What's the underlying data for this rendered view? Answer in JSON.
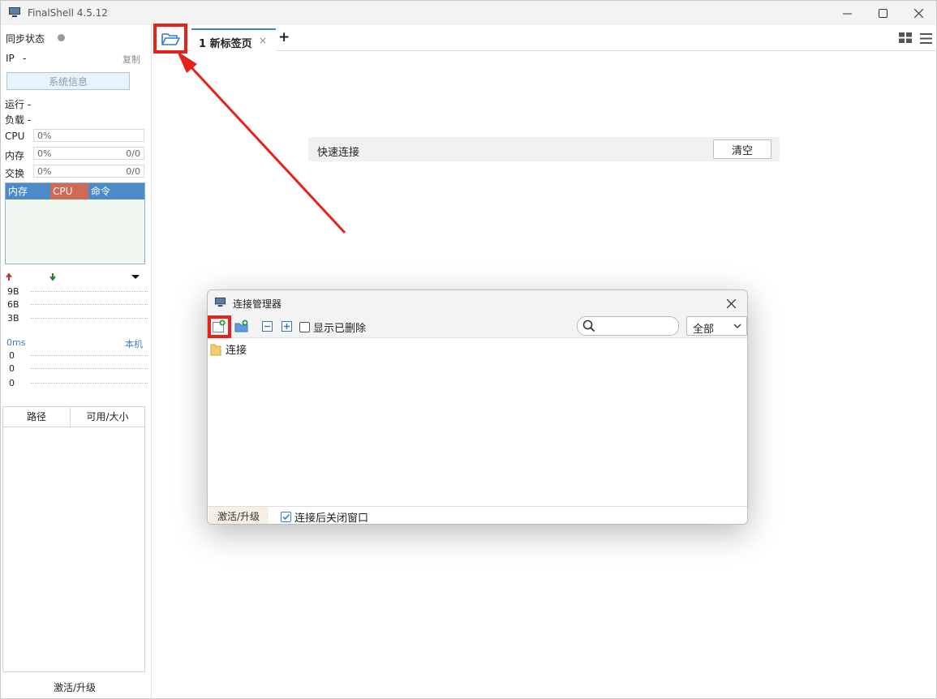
{
  "window": {
    "title": "FinalShell 4.5.12"
  },
  "sidebar": {
    "sync_status_label": "同步状态",
    "ip_label": "IP",
    "ip_value": "-",
    "copy_label": "复制",
    "sysinfo_button": "系统信息",
    "uptime": "运行 -",
    "load": "负载 -",
    "meters": [
      {
        "label": "CPU",
        "left": "0%",
        "right": ""
      },
      {
        "label": "内存",
        "left": "0%",
        "right": "0/0"
      },
      {
        "label": "交换",
        "left": "0%",
        "right": "0/0"
      }
    ],
    "process_headers": {
      "mem": "内存",
      "cpu": "CPU",
      "cmd": "命令"
    },
    "net_scale": [
      "9B",
      "6B",
      "3B"
    ],
    "ping_label": "0ms",
    "ping_target": "本机",
    "ping_scale": [
      "0",
      "0",
      "0"
    ],
    "disk_headers": {
      "path": "路径",
      "size": "可用/大小"
    },
    "activate_label": "激活/升级"
  },
  "tabs": {
    "items": [
      {
        "label": "1 新标签页",
        "close": "×"
      }
    ],
    "add": "+"
  },
  "quick_connect": {
    "label": "快速连接",
    "clear_button": "清空"
  },
  "dialog": {
    "title": "连接管理器",
    "show_deleted_label": "显示已删除",
    "search_placeholder": "",
    "filter_value": "全部",
    "tree": [
      {
        "label": "连接"
      }
    ],
    "activate_label": "激活/升级",
    "close_after_connect_label": "连接后关闭窗口",
    "close_after_connect_checked": true
  },
  "colors": {
    "accent": "#3b84d4",
    "highlight": "#e5231b",
    "cpu_header": "#cf6a56",
    "mem_header": "#4d8bc8"
  }
}
